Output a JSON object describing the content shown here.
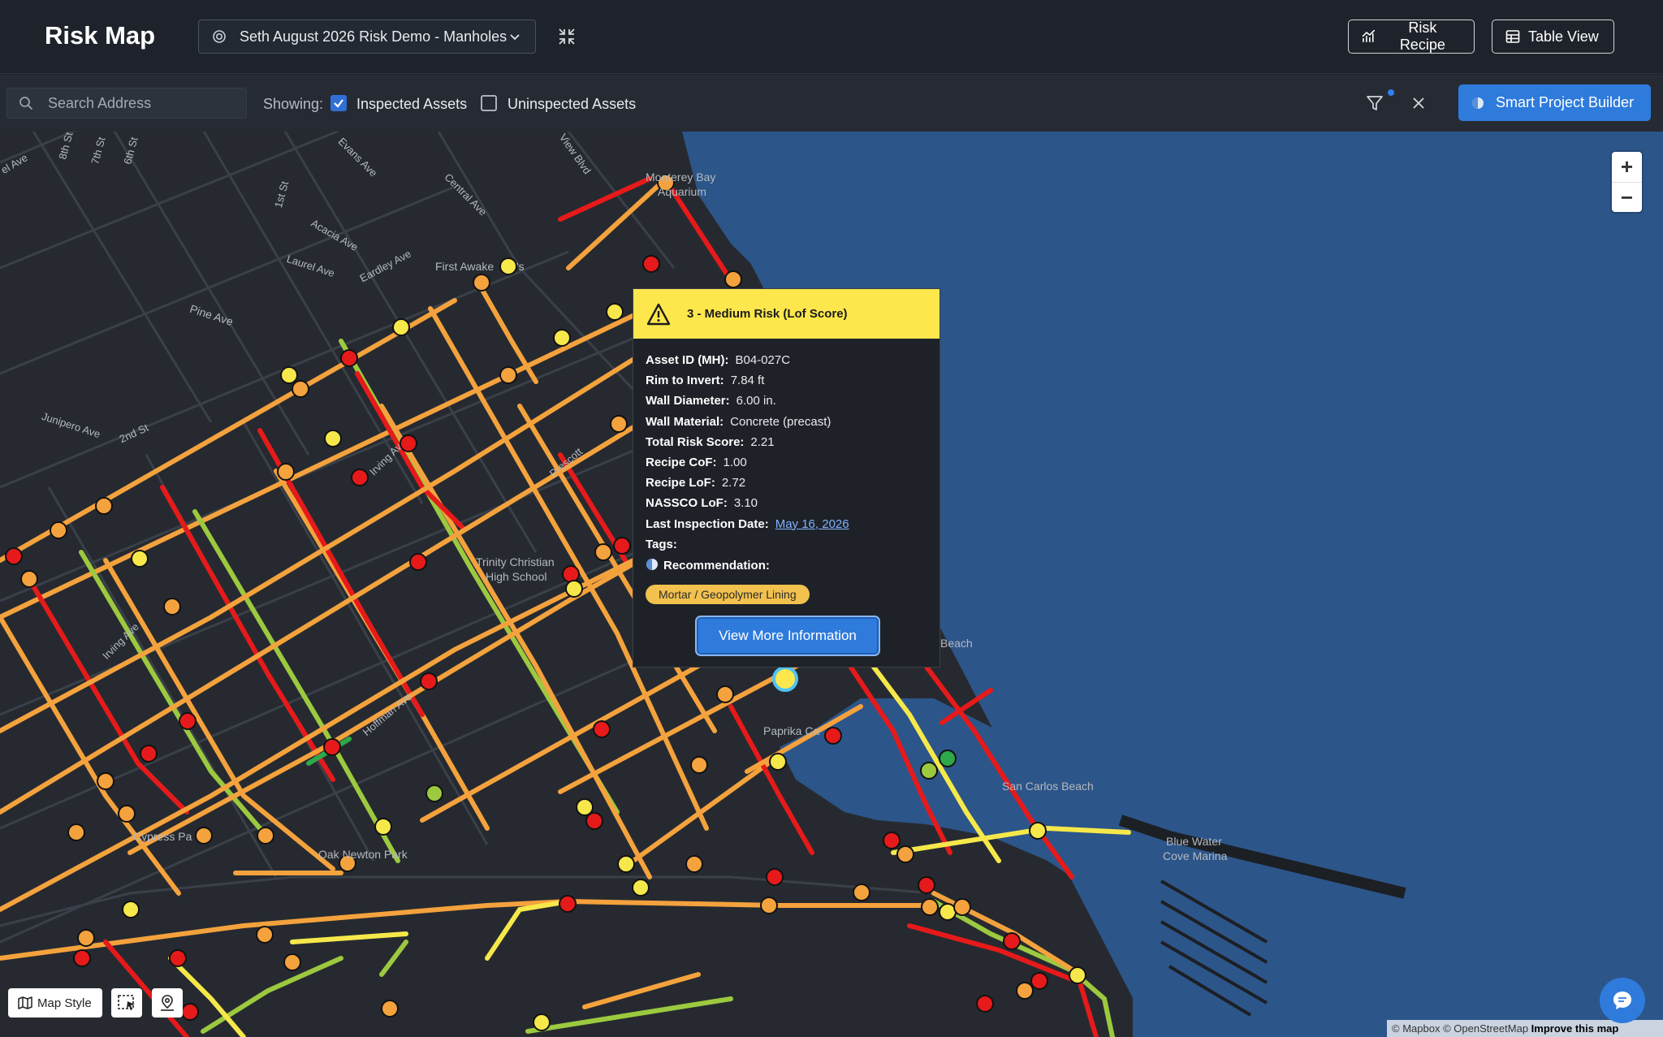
{
  "header": {
    "title": "Risk Map",
    "project_selector": "Seth August 2026 Risk Demo - Manholes",
    "risk_recipe_label": "Risk Recipe",
    "table_view_label": "Table View"
  },
  "filter_bar": {
    "search_placeholder": "Search Address",
    "showing_label": "Showing:",
    "inspected": {
      "label": "Inspected Assets",
      "checked": true
    },
    "uninspected": {
      "label": "Uninspected Assets",
      "checked": false
    },
    "smart_project_builder_label": "Smart Project Builder"
  },
  "colors": {
    "high": "#e61a1a",
    "medium_high": "#f4a23d",
    "medium": "#f6e84a",
    "low_medium": "#9cc93f",
    "low": "#2fa84a",
    "water": "#2c5589",
    "land": "#262a30",
    "accent": "#2e7bdc"
  },
  "popup": {
    "risk_title": "3 - Medium Risk (Lof Score)",
    "fields": [
      {
        "label": "Asset ID (MH):",
        "value": "B04-027C"
      },
      {
        "label": "Rim to Invert:",
        "value": "7.84 ft"
      },
      {
        "label": "Wall Diameter:",
        "value": "6.00 in."
      },
      {
        "label": "Wall Material:",
        "value": "Concrete (precast)"
      },
      {
        "label": "Total Risk Score:",
        "value": "2.21"
      },
      {
        "label": "Recipe CoF:",
        "value": "1.00"
      },
      {
        "label": "Recipe LoF:",
        "value": "2.72"
      },
      {
        "label": "NASSCO LoF:",
        "value": "3.10"
      }
    ],
    "last_inspection_label": "Last Inspection Date:",
    "last_inspection_value": "May 16, 2026",
    "tags_label": "Tags:",
    "recommendation_label": "Recommendation:",
    "recommendation_value": "Mortar / Geopolymer Lining",
    "view_more_label": "View More Information"
  },
  "map_labels": {
    "monterey_bay_1": "Monterey Bay",
    "monterey_bay_2": "Aquarium",
    "first_awake": "First Awake",
    "first_awake_end": "'s",
    "pine_ave": "Pine Ave",
    "laurel_ave": "Laurel Ave",
    "acacia_ave": "Acacia Ave",
    "central_ave": "Central Ave",
    "evans_ave": "Evans Ave",
    "eardley_ave": "Eardley Ave",
    "junipero_ave": "Junipero Ave",
    "second_st": "2nd St",
    "first_st": "1st St",
    "eighth_st": "8th St",
    "seventh_st": "7th St",
    "sixth_st": "6th St",
    "irving_ave": "Irving Ave",
    "irving_av": "Irving Av",
    "prescott": "Prescott",
    "hoffman_ave": "Hoffman Ave",
    "trinity_1": "Trinity Christian",
    "trinity_2": "High School",
    "paprika": "Paprika Ca",
    "oak_newton": "Oak Newton Park",
    "cypress": "Cypress Pa",
    "san_carlos": "San Carlos Beach",
    "blue_water_1": "Blue Water",
    "blue_water_2": "Cove Marina",
    "beach": "Beach",
    "view_blvd": "View Blvd",
    "el_ave": "el Ave"
  },
  "bottom_controls": {
    "map_style_label": "Map Style"
  },
  "attribution": {
    "mapbox": "© Mapbox",
    "osm": "© OpenStreetMap",
    "improve": "Improve this map"
  },
  "zoom": {
    "plus": "+",
    "minus": "−"
  }
}
